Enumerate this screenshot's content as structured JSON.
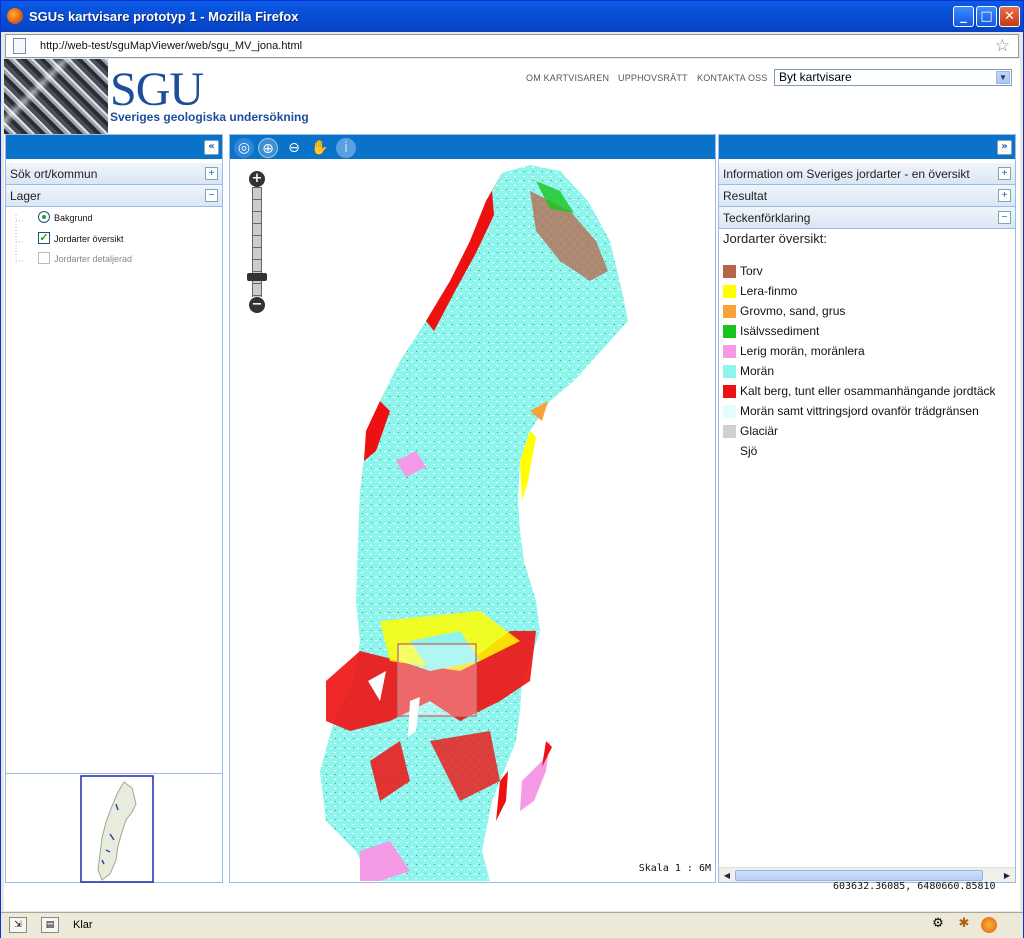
{
  "window": {
    "title": "SGUs kartvisare prototyp 1 - Mozilla Firefox",
    "url": "http://web-test/sguMapViewer/web/sgu_MV_jona.html"
  },
  "header": {
    "logo": "SGU",
    "logo_sub": "Sveriges geologiska undersökning",
    "links": [
      "OM KARTVISAREN",
      "UPPHOVSRÄTT",
      "KONTAKTA OSS"
    ],
    "select_value": "Byt kartvisare"
  },
  "left": {
    "search_header": "Sök ort/kommun",
    "layers_header": "Lager",
    "layers": [
      {
        "label": "Bakgrund"
      },
      {
        "label": "Jordarter översikt"
      },
      {
        "label": "Jordarter detaljerad"
      }
    ]
  },
  "map": {
    "scale": "Skala 1 : 6M"
  },
  "right": {
    "info_header": "Information om Sveriges jordarter - en översikt",
    "result_header": "Resultat",
    "legend_header": "Teckenförklaring",
    "legend_title": "Jordarter översikt:",
    "legend": [
      {
        "label": "Torv",
        "color": "#b5664a"
      },
      {
        "label": "Lera-finmo",
        "color": "#ffff00"
      },
      {
        "label": "Grovmo, sand, grus",
        "color": "#f8a33a"
      },
      {
        "label": "Isälvssediment",
        "color": "#19c51d"
      },
      {
        "label": "Lerig morän, moränlera",
        "color": "#f59ae6"
      },
      {
        "label": "Morän",
        "color": "#8ef4ee"
      },
      {
        "label": "Kalt berg, tunt eller osammanhängande jordtäck",
        "color": "#ee1111"
      },
      {
        "label": "Morän samt vittringsjord ovanför trädgränsen",
        "color": "#e4fcfb"
      },
      {
        "label": "Glaciär",
        "color": "#d0d0d0"
      },
      {
        "label": "Sjö",
        "color": "#ffffff"
      }
    ]
  },
  "coords": "603632.36085, 6480660.85810",
  "status": "Klar"
}
